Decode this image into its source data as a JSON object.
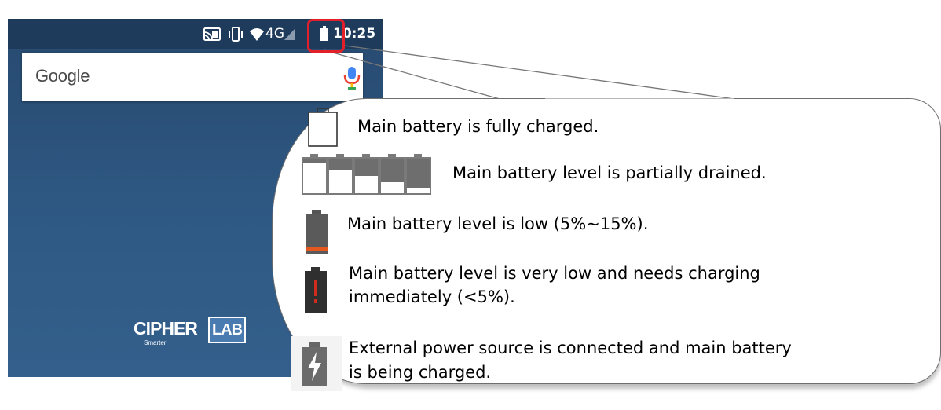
{
  "status_bar": {
    "network": "4G",
    "time": "10:25",
    "icons": [
      "cast-icon",
      "vibrate-icon",
      "wifi-icon",
      "signal-icon",
      "battery-icon"
    ]
  },
  "search": {
    "logo_text": "Google",
    "icon": "mic-icon"
  },
  "brand": {
    "cipher": "CIPHER",
    "lab": "LAB",
    "tagline": "Smarter"
  },
  "legend": {
    "items": [
      {
        "icon": "battery-full-icon",
        "text": "Main battery is fully charged."
      },
      {
        "icon": "battery-partial-icon",
        "text": "Main battery level is partially drained."
      },
      {
        "icon": "battery-low-icon",
        "text": "Main battery level is low (5%~15%)."
      },
      {
        "icon": "battery-very-low-icon",
        "text_line1": "Main battery level is very low and needs charging",
        "text_line2": "immediately (<5%)."
      },
      {
        "icon": "battery-charging-icon",
        "text_line1": "External power source is connected and main battery",
        "text_line2": "is being charged."
      }
    ]
  },
  "colors": {
    "highlight": "#e3202a",
    "low_battery": "#e4571e",
    "very_low_battery": "#d12b1e",
    "phone_background": "#2f5a85"
  }
}
